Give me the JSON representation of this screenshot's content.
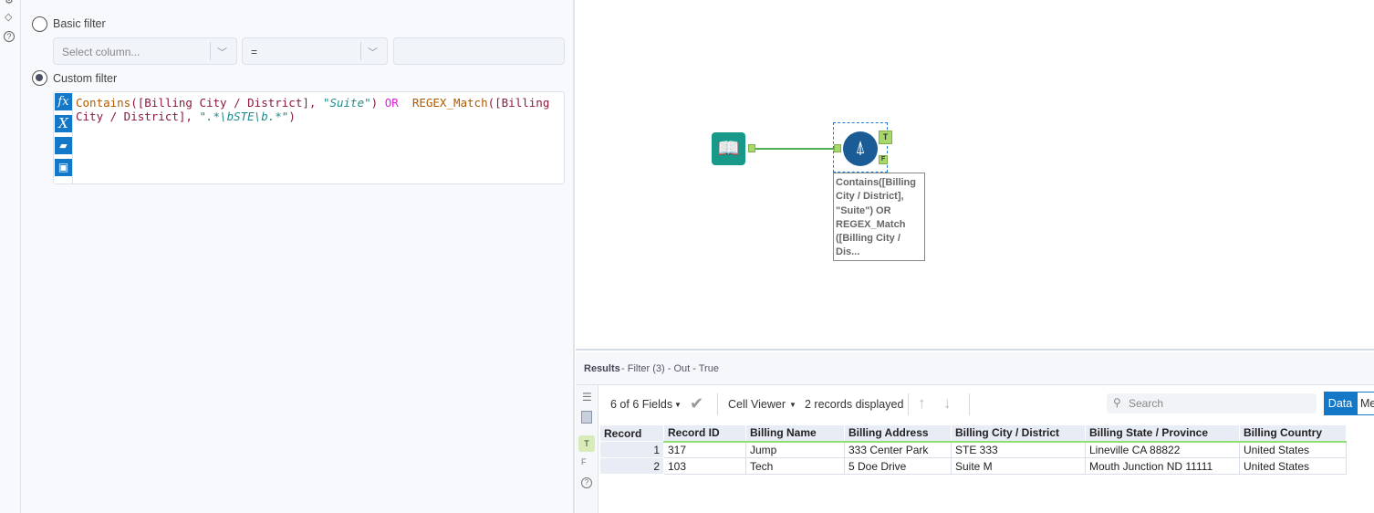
{
  "config": {
    "basic_filter_label": "Basic filter",
    "column_placeholder": "Select column...",
    "operator_value": "=",
    "value_field": "",
    "custom_filter_label": "Custom filter",
    "expression_parts": [
      "Contains",
      "([Billing City / District], ",
      "\"Suite\"",
      ") ",
      "OR",
      "  ",
      "REGEX_Match",
      "([Billing City / District], ",
      "\".*\\bSTE\\b.*\"",
      ")"
    ]
  },
  "canvas": {
    "filter_annotation": "Contains([Billing City / District], \"Suite\") OR REGEX_Match ([Billing City / Dis...",
    "true_anchor": "T",
    "false_anchor": "F"
  },
  "results": {
    "title": "Results",
    "subtitle": " - Filter (3) - Out - True",
    "fields_label": "6 of 6 Fields",
    "cell_viewer_label": "Cell Viewer",
    "records_label": "2 records displayed",
    "search_placeholder": "Search",
    "data_tab": "Data",
    "metadata_tab": "Metadata",
    "columns": [
      "Record",
      "Record ID",
      "Billing Name",
      "Billing Address",
      "Billing City / District",
      "Billing State / Province",
      "Billing Country"
    ],
    "rows": [
      [
        "1",
        "317",
        "Jump",
        "333 Center Park",
        "STE 333",
        "Lineville CA 88822",
        "United States"
      ],
      [
        "2",
        "103",
        "Tech",
        "5 Doe Drive",
        "Suite M",
        "Mouth Junction ND 11111",
        "United States"
      ]
    ]
  },
  "colors": {
    "accent": "#1478c8",
    "anchor_green": "#a8d86a",
    "filter_tool": "#1b5c96",
    "input_tool": "#18998a"
  }
}
